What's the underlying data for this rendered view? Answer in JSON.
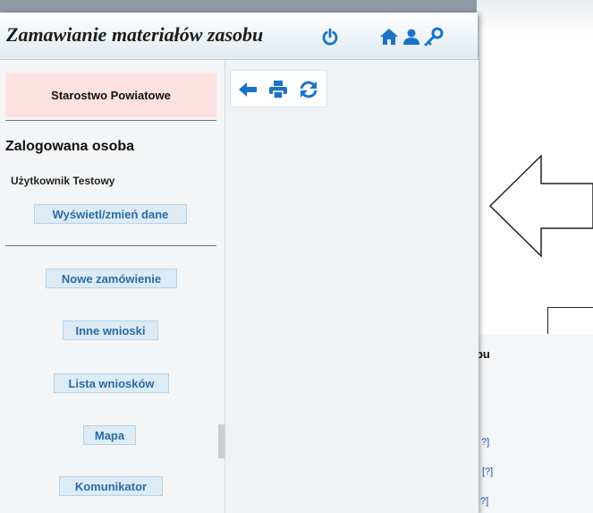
{
  "header": {
    "title": "Zamawianie materiałów zasobu",
    "icons": {
      "power": "power-icon",
      "home": "home-icon",
      "user": "user-icon",
      "key": "key-icon"
    },
    "accent_color": "#1a73c9"
  },
  "sidebar": {
    "organization": "Starostwo Powiatowe",
    "logged_in_heading": "Zalogowana osoba",
    "user_name": "Użytkownik Testowy",
    "edit_data_button": "Wyświetl/zmień dane",
    "menu": [
      {
        "label": "Nowe zamówienie"
      },
      {
        "label": "Inne wnioski"
      },
      {
        "label": "Lista wniosków"
      },
      {
        "label": "Mapa"
      },
      {
        "label": "Komunikator"
      }
    ]
  },
  "toolbar": {
    "icons": [
      "back-arrow-icon",
      "print-icon",
      "refresh-icon"
    ]
  },
  "background": {
    "partial_title": "obu",
    "partial_links": [
      "?]",
      "[?]",
      "?]"
    ]
  }
}
